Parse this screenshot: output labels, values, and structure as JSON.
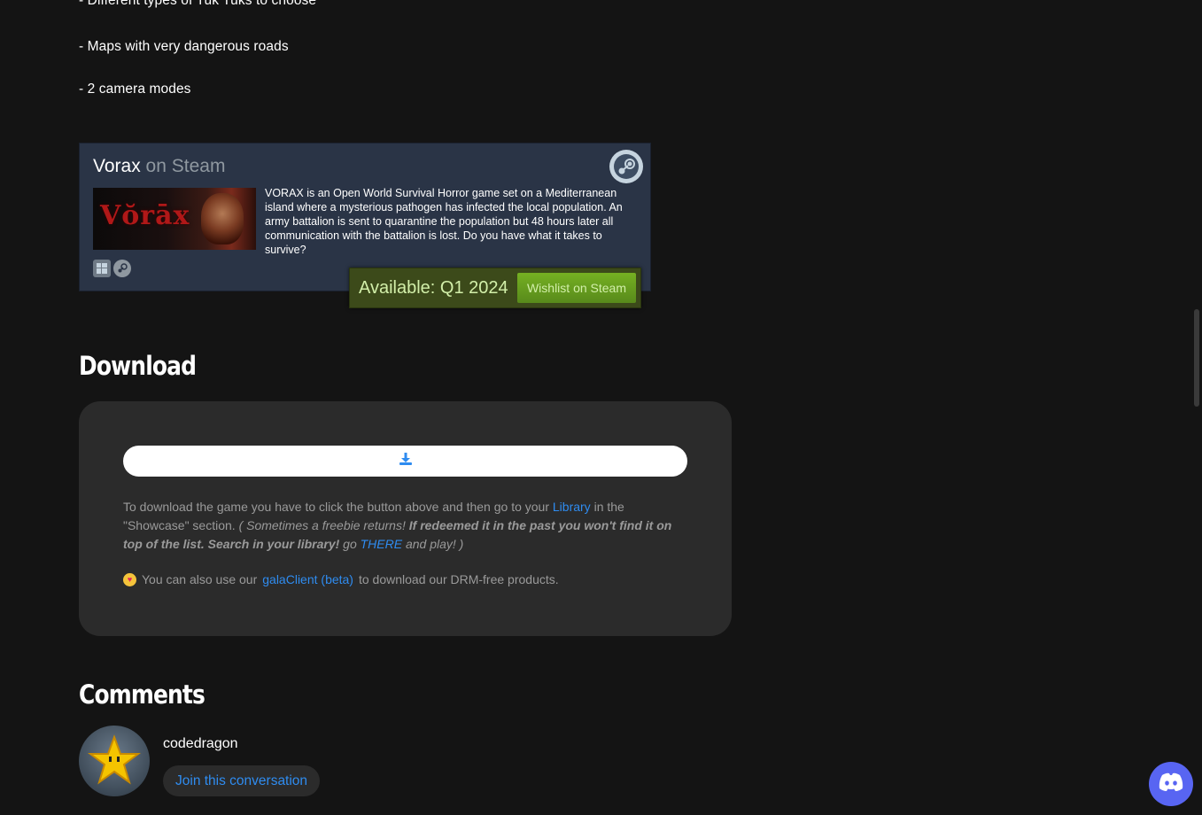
{
  "features": [
    "- Different types of Tuk Tuks to choose",
    "- Maps with very dangerous roads",
    "- 2 camera modes"
  ],
  "steam_widget": {
    "game_name": "Vorax",
    "on_steam": "on Steam",
    "capsule_logo": "Vŏrāx",
    "description": "VORAX is an Open World Survival Horror game set on a Mediterranean island where a mysterious pathogen has infected the local population. An army battalion is sent to quarantine the population but 48 hours later all communication with the battalion is lost. Do you have what it takes to survive?",
    "availability": "Available: Q1 2024",
    "wishlist_label": "Wishlist on Steam",
    "platforms": [
      "windows-icon",
      "steam-icon"
    ]
  },
  "download": {
    "heading": "Download",
    "instructions_1": "To download the game you have to click the button above and then go to your",
    "library_link": "Library",
    "instructions_2": "in the \"Showcase\" section.",
    "italic_1": "( Sometimes a freebie returns!",
    "bold_italic": "If redeemed it in the past you won't find it on top of the list. Search in your library!",
    "italic_2": "go",
    "there_link": "THERE",
    "italic_3": "and play! )",
    "gala_text_1": "You can also use our",
    "gala_link": "galaClient (beta)",
    "gala_text_2": "to download our DRM-free products."
  },
  "comments": {
    "heading": "Comments",
    "username": "codedragon",
    "join_label": "Join this conversation"
  },
  "colors": {
    "background": "#141414",
    "panel": "#2b2b2b",
    "link": "#2f8cf0",
    "steam_green": "#75b022",
    "discord": "#5865f2"
  }
}
